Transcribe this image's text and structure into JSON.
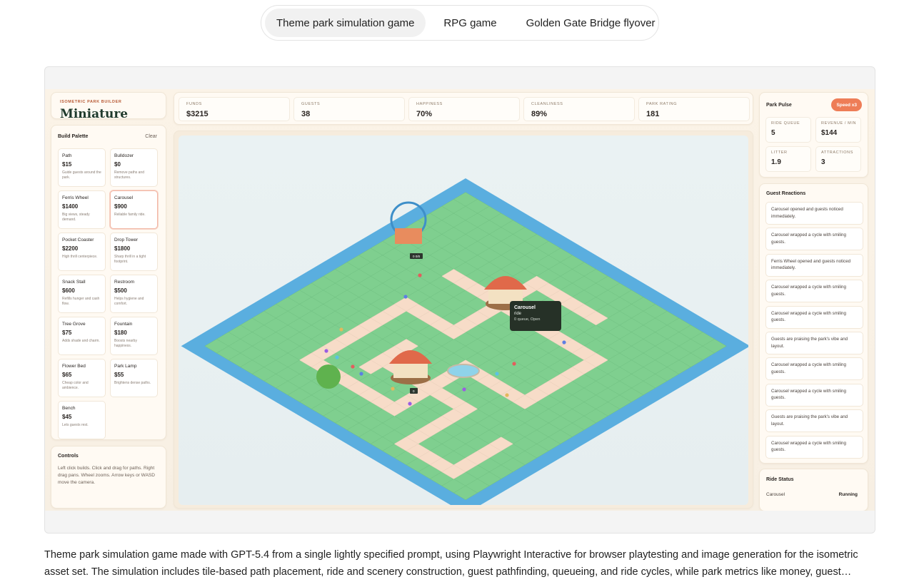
{
  "tabs": [
    {
      "label": "Theme park simulation game",
      "active": true
    },
    {
      "label": "RPG game",
      "active": false
    },
    {
      "label": "Golden Gate Bridge flyover",
      "active": false
    }
  ],
  "game": {
    "brand": {
      "kicker": "ISOMETRIC PARK BUILDER",
      "name": "Miniature"
    },
    "palette": {
      "title": "Build Palette",
      "clear": "Clear",
      "items": [
        {
          "name": "Path",
          "price": "$15",
          "desc": "Guide guests around the park."
        },
        {
          "name": "Bulldozer",
          "price": "$0",
          "desc": "Remove paths and structures."
        },
        {
          "name": "Ferris Wheel",
          "price": "$1400",
          "desc": "Big views, steady demand."
        },
        {
          "name": "Carousel",
          "price": "$900",
          "desc": "Reliable family ride.",
          "selected": true
        },
        {
          "name": "Pocket Coaster",
          "price": "$2200",
          "desc": "High thrill centerpiece."
        },
        {
          "name": "Drop Tower",
          "price": "$1800",
          "desc": "Sharp thrill in a tight footprint."
        },
        {
          "name": "Snack Stall",
          "price": "$600",
          "desc": "Refills hunger and cash flow."
        },
        {
          "name": "Restroom",
          "price": "$500",
          "desc": "Helps hygiene and comfort."
        },
        {
          "name": "Tree Grove",
          "price": "$75",
          "desc": "Adds shade and charm."
        },
        {
          "name": "Fountain",
          "price": "$180",
          "desc": "Boosts nearby happiness."
        },
        {
          "name": "Flower Bed",
          "price": "$65",
          "desc": "Cheap color and ambience."
        },
        {
          "name": "Park Lamp",
          "price": "$55",
          "desc": "Brightens dense paths."
        },
        {
          "name": "Bench",
          "price": "$45",
          "desc": "Lets guests rest."
        }
      ]
    },
    "controls": {
      "title": "Controls",
      "text": "Left click builds. Click and drag for paths. Right drag pans. Wheel zooms. Arrow keys or WASD move the camera."
    },
    "stats": [
      {
        "label": "FUNDS",
        "value": "$3215"
      },
      {
        "label": "GUESTS",
        "value": "38"
      },
      {
        "label": "HAPPINESS",
        "value": "70%"
      },
      {
        "label": "CLEANLINESS",
        "value": "89%"
      },
      {
        "label": "PARK RATING",
        "value": "181"
      }
    ],
    "pulse": {
      "title": "Park Pulse",
      "speed": "Speed x3",
      "metrics": [
        {
          "label": "RIDE QUEUE",
          "value": "5"
        },
        {
          "label": "REVENUE / MIN",
          "value": "$144"
        },
        {
          "label": "LITTER",
          "value": "1.9"
        },
        {
          "label": "ATTRACTIONS",
          "value": "3"
        }
      ]
    },
    "reactions": {
      "title": "Guest Reactions",
      "items": [
        "Carousel opened and guests noticed immediately.",
        "Carousel wrapped a cycle with smiling guests.",
        "Ferris Wheel opened and guests noticed immediately.",
        "Carousel wrapped a cycle with smiling guests.",
        "Carousel wrapped a cycle with smiling guests.",
        "Guests are praising the park's vibe and layout.",
        "Carousel wrapped a cycle with smiling guests.",
        "Carousel wrapped a cycle with smiling guests.",
        "Guests are praising the park's vibe and layout.",
        "Carousel wrapped a cycle with smiling guests."
      ]
    },
    "ride_status": {
      "title": "Ride Status",
      "ride": "Carousel",
      "state": "Running"
    },
    "tooltip": {
      "title": "Carousel",
      "kind": "ride",
      "info": "0 queue, Open"
    },
    "ride_tags": [
      "0 0/8",
      "0"
    ]
  },
  "caption": "Theme park simulation game made with GPT-5.4 from a single lightly specified prompt, using Playwright Interactive for browser playtesting and image generation for the isometric asset set. The simulation includes tile-based path placement, ride and scenery construction, guest pathfinding, queueing, and ride cycles, while park metrics like money, guest…",
  "colors": {
    "grass": "#7fcf8f",
    "path": "#f7dcc8",
    "water": "#5aaedf",
    "accent": "#ee7d57"
  }
}
